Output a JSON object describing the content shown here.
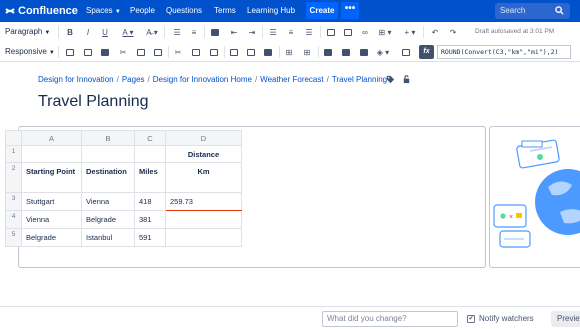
{
  "nav": {
    "logo": "Confluence",
    "items": [
      "Spaces",
      "People",
      "Questions",
      "Terms",
      "Learning Hub"
    ],
    "create": "Create",
    "more": "•••",
    "search_placeholder": "Search"
  },
  "toolbar": {
    "paragraph": "Paragraph",
    "responsive": "Responsive",
    "draft_status": "Draft autosaved at 3:01 PM",
    "fx_label": "fx",
    "formula": "ROUND(Convert(C3,\"km\",\"mi\"),2)"
  },
  "breadcrumb": [
    "Design for Innovation",
    "Pages",
    "Design for Innovation Home",
    "Weather Forecast",
    "Travel Planning"
  ],
  "page_title": "Travel Planning",
  "sheet": {
    "columns": [
      "A",
      "B",
      "C",
      "D"
    ],
    "rows": [
      {
        "num": "1",
        "cells": [
          "",
          "",
          "",
          "Distance"
        ]
      },
      {
        "num": "2",
        "cells": [
          "Starting Point",
          "Destination",
          "Miles",
          "Km"
        ]
      },
      {
        "num": "3",
        "cells": [
          "Stuttgart",
          "Vienna",
          "418",
          "259.73"
        ]
      },
      {
        "num": "4",
        "cells": [
          "Vienna",
          "Belgrade",
          "381",
          ""
        ]
      },
      {
        "num": "5",
        "cells": [
          "Belgrade",
          "Istanbul",
          "591",
          ""
        ]
      }
    ]
  },
  "footer": {
    "change_placeholder": "What did you change?",
    "notify_label": "Notify watchers",
    "notify_checked": "✔",
    "preview": "Preview"
  },
  "colors": {
    "brand": "#0052cc",
    "create": "#0065ff",
    "accent_underline": "#de350b"
  }
}
